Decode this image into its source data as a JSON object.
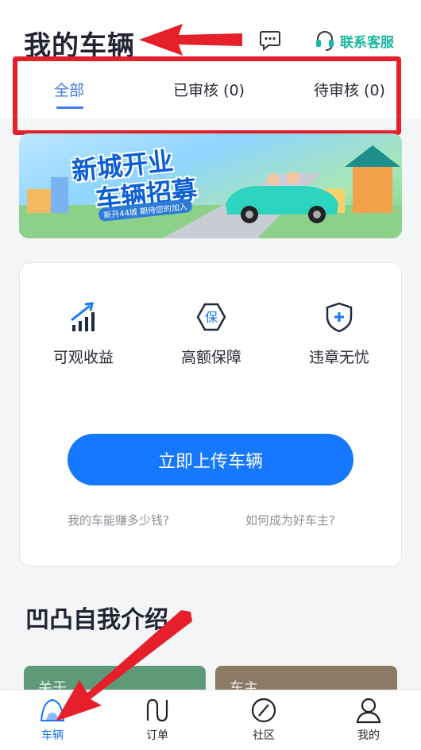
{
  "header": {
    "title": "我的车辆",
    "service_label": "联系客服"
  },
  "tabs": [
    {
      "label": "全部",
      "active": true
    },
    {
      "label": "已审核 (0)",
      "active": false
    },
    {
      "label": "待审核 (0)",
      "active": false
    }
  ],
  "banner": {
    "title_line1": "新城开业",
    "title_line2": "车辆招募",
    "subtitle": "新开44城   期待您的加入"
  },
  "features": [
    {
      "label": "可观收益",
      "icon": "growth-chart-icon"
    },
    {
      "label": "高额保障",
      "icon": "insurance-icon",
      "glyph": "保"
    },
    {
      "label": "违章无忧",
      "icon": "shield-plus-icon"
    }
  ],
  "upload_button": "立即上传车辆",
  "links": {
    "earn": "我的车能赚多少钱?",
    "good_owner": "如何成为好车主?"
  },
  "section": {
    "title": "凹凸自我介绍",
    "thumb_left": "关于",
    "thumb_right": "车主"
  },
  "bottom_nav": [
    {
      "label": "车辆",
      "icon": "car-tab-icon",
      "active": true
    },
    {
      "label": "订单",
      "icon": "order-tab-icon",
      "active": false
    },
    {
      "label": "社区",
      "icon": "community-tab-icon",
      "active": false
    },
    {
      "label": "我的",
      "icon": "profile-tab-icon",
      "active": false
    }
  ],
  "colors": {
    "accent": "#1677ff",
    "service": "#16b89e",
    "annotation": "#e5202a"
  }
}
